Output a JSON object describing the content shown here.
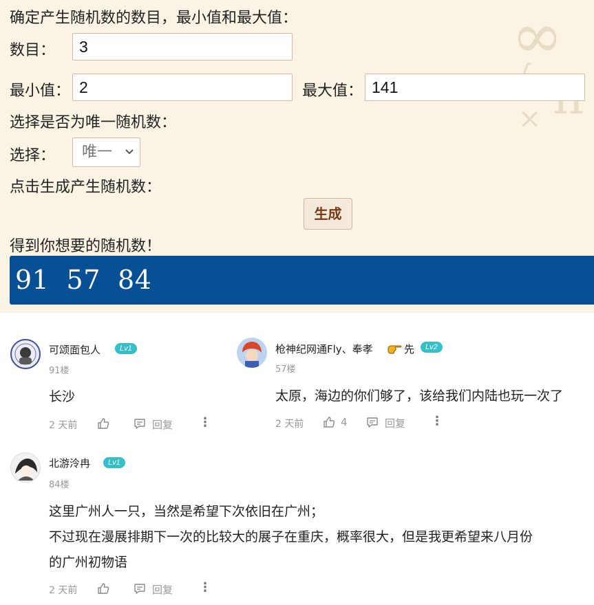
{
  "generator": {
    "prompt_title": "确定产生随机数的数目，最小值和最大值：",
    "count_label": "数目：",
    "count_value": "3",
    "min_label": "最小值：",
    "min_value": "2",
    "max_label": "最大值：",
    "max_value": "141",
    "unique_title": "选择是否为唯一随机数：",
    "select_label": "选择：",
    "select_value": "唯一",
    "click_title": "点击生成产生随机数：",
    "generate_button": "生成",
    "result_title": "得到你想要的随机数！",
    "result_numbers": "91  57  84",
    "result_bg": "#085095"
  },
  "comments": [
    {
      "username": "可颂面包人",
      "level": "Lv1",
      "floor": "91楼",
      "text": "长沙",
      "time": "2 天前",
      "likes": "",
      "reply": "回复"
    },
    {
      "username": "枪神纪网通Fly、奉孝",
      "username_suffix": "先",
      "level": "Lv2",
      "floor": "57楼",
      "text": "太原，海边的你们够了，该给我们内陆也玩一次了",
      "time": "2 天前",
      "likes": "4",
      "reply": "回复"
    },
    {
      "username": "北游泠冉",
      "level": "Lv1",
      "floor": "84楼",
      "text_lines": [
        "这里广州人一只，当然是希望下次依旧在广州；",
        "不过现在漫展排期下一次的比较大的展子在重庆，概率很大，但是我更希望来八月份",
        "的广州初物语"
      ],
      "time": "2 天前",
      "likes": "",
      "reply": "回复"
    }
  ],
  "icons": {
    "like": "thumbs-up-icon",
    "reply": "comment-icon",
    "more": "more-vertical-icon",
    "pointing": "pointing-hand-icon",
    "dropdown": "chevron-down-icon"
  },
  "colors": {
    "panel_bg": "#fbf4e4",
    "level_badge": "#33c0c8",
    "button_text": "#7a3a13"
  }
}
